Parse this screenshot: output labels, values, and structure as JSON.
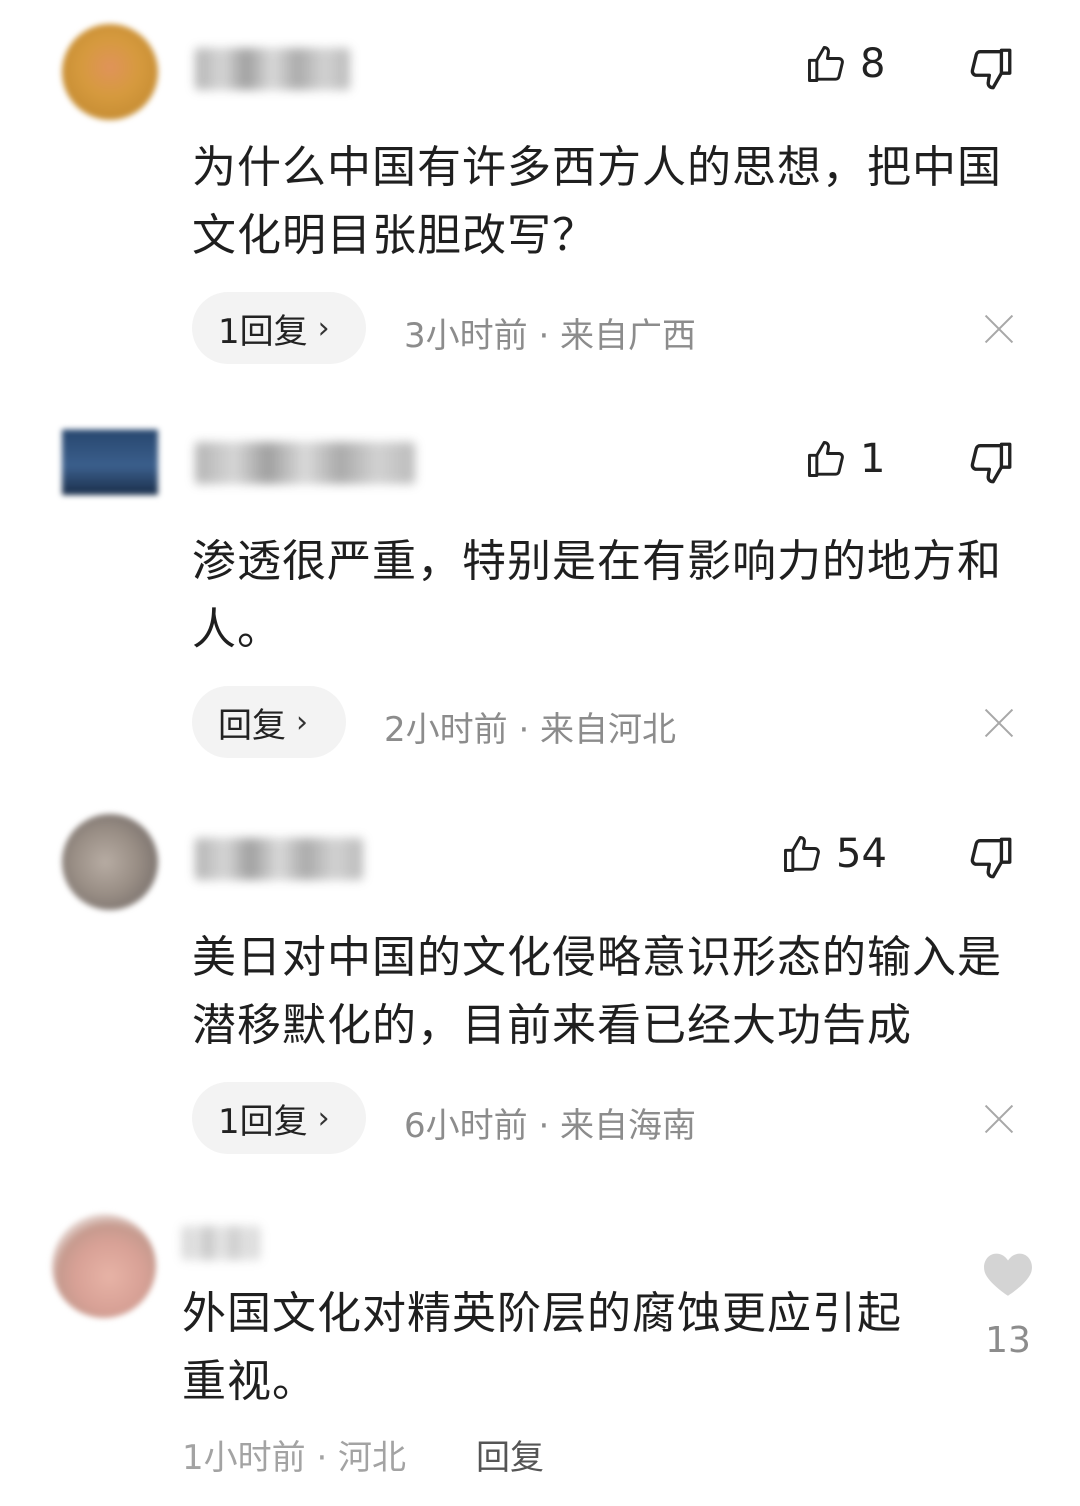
{
  "comments": [
    {
      "likes": "8",
      "text": "为什么中国有许多西方人的思想，把中国文化明目张胆改写？",
      "reply_label": "1回复",
      "meta": "3小时前 · 来自广西"
    },
    {
      "likes": "1",
      "text": "渗透很严重，特别是在有影响力的地方和人。",
      "reply_label": "回复",
      "meta": "2小时前 · 来自河北"
    },
    {
      "likes": "54",
      "text": "美日对中国的文化侵略意识形态的输入是潜移默化的，目前来看已经大功告成",
      "reply_label": "1回复",
      "meta": "6小时前 · 来自海南"
    }
  ],
  "bottom_comment": {
    "text": "外国文化对精英阶层的腐蚀更应引起重视。",
    "likes": "13",
    "time": "1小时前 · 河北",
    "reply_label": "回复"
  },
  "icons": {
    "like": "thumbs-up-icon",
    "dislike": "thumbs-down-icon",
    "close": "close-icon",
    "heart": "heart-icon",
    "chevron": "chevron-right-icon"
  },
  "colors": {
    "text": "#1f1f1f",
    "meta": "#8c8c8c",
    "pill_bg": "#f3f3f3",
    "heart": "#d4d4d4"
  }
}
